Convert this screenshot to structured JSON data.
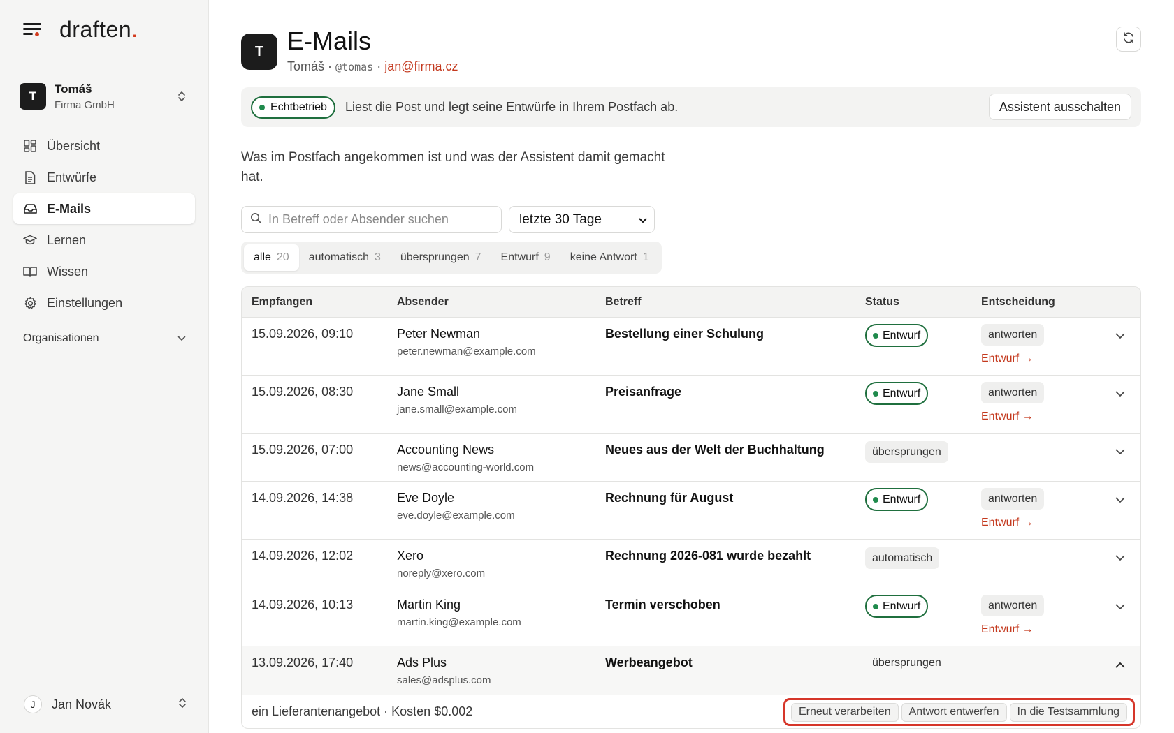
{
  "brand": {
    "name": "draften",
    "dot": "."
  },
  "account": {
    "initial": "T",
    "name": "Tomáš",
    "org": "Firma GmbH"
  },
  "nav": {
    "items": [
      {
        "label": "Übersicht",
        "icon": "grid-icon"
      },
      {
        "label": "Entwürfe",
        "icon": "document-icon"
      },
      {
        "label": "E-Mails",
        "icon": "inbox-icon"
      },
      {
        "label": "Lernen",
        "icon": "graduation-cap-icon"
      },
      {
        "label": "Wissen",
        "icon": "book-icon"
      },
      {
        "label": "Einstellungen",
        "icon": "gear-icon"
      }
    ],
    "active_index": 2,
    "organizations_label": "Organisationen"
  },
  "user": {
    "initial": "J",
    "name": "Jan Novák"
  },
  "header": {
    "initial": "T",
    "title": "E-Mails",
    "name": "Tomáš",
    "sep1": " · ",
    "handle": "@tomas",
    "sep2": " · ",
    "email": "jan@firma.cz"
  },
  "banner": {
    "status_label": "Echtbetrieb",
    "text": "Liest die Post und legt seine Entwürfe in Ihrem Postfach ab.",
    "disable_button": "Assistent ausschalten"
  },
  "description": "Was im Postfach angekommen ist und was der Assistent damit gemacht hat.",
  "filters": {
    "search_placeholder": "In Betreff oder Absender suchen",
    "range_value": "letzte 30 Tage"
  },
  "segments": [
    {
      "label": "alle",
      "count": "20"
    },
    {
      "label": "automatisch",
      "count": "3"
    },
    {
      "label": "übersprungen",
      "count": "7"
    },
    {
      "label": "Entwurf",
      "count": "9"
    },
    {
      "label": "keine Antwort",
      "count": "1"
    }
  ],
  "table": {
    "headers": [
      "Empfangen",
      "Absender",
      "Betreff",
      "Status",
      "Entscheidung"
    ],
    "rows": [
      {
        "date": "15.09.2026, 09:10",
        "name": "Peter Newman",
        "email": "peter.newman@example.com",
        "subject": "Bestellung einer Schulung",
        "status": "Entwurf",
        "decision": "antworten",
        "link": "Entwurf →"
      },
      {
        "date": "15.09.2026, 08:30",
        "name": "Jane Small",
        "email": "jane.small@example.com",
        "subject": "Preisanfrage",
        "status": "Entwurf",
        "decision": "antworten",
        "link": "Entwurf →"
      },
      {
        "date": "15.09.2026, 07:00",
        "name": "Accounting News",
        "email": "news@accounting-world.com",
        "subject": "Neues aus der Welt der Buchhaltung",
        "status": "übersprungen",
        "decision": "",
        "link": ""
      },
      {
        "date": "14.09.2026, 14:38",
        "name": "Eve Doyle",
        "email": "eve.doyle@example.com",
        "subject": "Rechnung für August",
        "status": "Entwurf",
        "decision": "antworten",
        "link": "Entwurf →"
      },
      {
        "date": "14.09.2026, 12:02",
        "name": "Xero",
        "email": "noreply@xero.com",
        "subject": "Rechnung 2026-081 wurde bezahlt",
        "status": "automatisch",
        "decision": "",
        "link": ""
      },
      {
        "date": "14.09.2026, 10:13",
        "name": "Martin King",
        "email": "martin.king@example.com",
        "subject": "Termin verschoben",
        "status": "Entwurf",
        "decision": "antworten",
        "link": "Entwurf →"
      },
      {
        "date": "13.09.2026, 17:40",
        "name": "Ads Plus",
        "email": "sales@adsplus.com",
        "subject": "Werbeangebot",
        "status": "übersprungen",
        "decision": "",
        "link": ""
      }
    ],
    "expanded": {
      "summary": "ein Lieferantenangebot · Kosten $0.002",
      "actions": [
        "Erneut verarbeiten",
        "Antwort entwerfen",
        "In die Testsammlung"
      ]
    }
  },
  "colors": {
    "accent": "#c4391e",
    "green": "#1f8a4c",
    "highlight": "#d6362a"
  }
}
